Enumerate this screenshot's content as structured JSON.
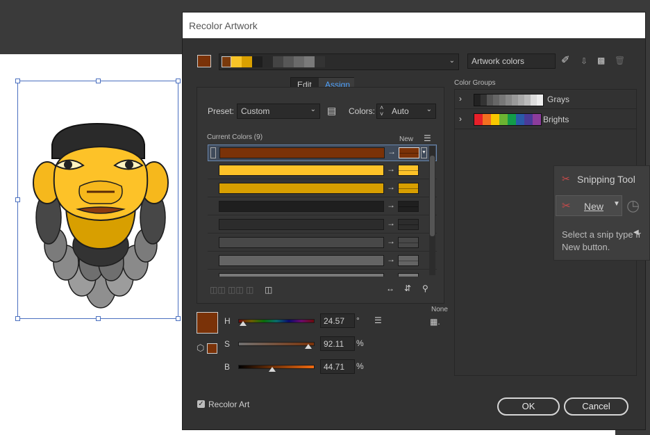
{
  "dialog": {
    "title": "Recolor Artwork",
    "artwork_colors_field": "Artwork colors",
    "tabs": [
      {
        "label": "Edit"
      },
      {
        "label": "Assign"
      }
    ],
    "preset_label": "Preset:",
    "preset_value": "Custom",
    "colors_label": "Colors:",
    "colors_value": "Auto",
    "current_colors_label": "Current Colors (9)",
    "new_label": "New",
    "none_label": "None",
    "hsb": {
      "h_label": "H",
      "h_value": "24.57",
      "h_unit": "°",
      "s_label": "S",
      "s_value": "92.11",
      "s_unit": "%",
      "b_label": "B",
      "b_value": "44.71",
      "b_unit": "%"
    },
    "recolor_art_label": "Recolor Art",
    "ok_label": "OK",
    "cancel_label": "Cancel",
    "color_groups_label": "Color Groups",
    "groups": [
      {
        "name": "Grays",
        "colors": [
          "#222222",
          "#333333",
          "#555555",
          "#666666",
          "#777777",
          "#888888",
          "#999999",
          "#aaaaaa",
          "#bbbbbb",
          "#dddddd",
          "#eeeeee"
        ]
      },
      {
        "name": "Brights",
        "colors": [
          "#e8202a",
          "#f37020",
          "#f8c800",
          "#6cb432",
          "#129c4a",
          "#2a5aa8",
          "#4a3a98",
          "#8c3c9c"
        ]
      }
    ],
    "header_strip_colors": [
      "#7a3a0c",
      "#f8c428",
      "#d9a000",
      "#1e1e1e",
      "#2a2a2a",
      "#444444",
      "#575757",
      "#6a6a6a",
      "#7a7a7a",
      "#333333"
    ],
    "current_colors": [
      {
        "current": "#7a3208",
        "new": "#7a3208"
      },
      {
        "current": "#fdc228",
        "new": "#fdc228"
      },
      {
        "current": "#d89f00",
        "new": "#d89f00"
      },
      {
        "current": "#1f1f1f",
        "new": "#1f1f1f"
      },
      {
        "current": "#2c2c2c",
        "new": "#2c2c2c"
      },
      {
        "current": "#484848",
        "new": "#484848"
      },
      {
        "current": "#646464",
        "new": "#646464"
      },
      {
        "current": "#7a7a7a",
        "new": "#7a7a7a"
      }
    ],
    "selected_color": "#7a3208"
  },
  "snipping_tool": {
    "title": "Snipping Tool",
    "new_label": "New",
    "hint": "Select a snip type fr",
    "hint2": "New button."
  },
  "icons": [
    "eyedropper-icon",
    "save-group-icon",
    "folder-icon",
    "trash-icon",
    "menu-icon",
    "cube-icon",
    "clock-icon"
  ]
}
